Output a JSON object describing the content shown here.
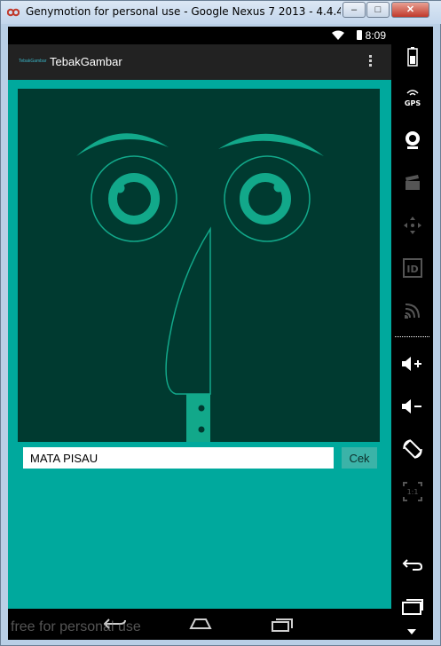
{
  "window": {
    "title": "Genymotion for personal use - Google Nexus 7 2013 - 4.4.4 - API...",
    "min_glyph": "–",
    "max_glyph": "□",
    "close_glyph": "✕"
  },
  "statusbar": {
    "time": "8:09"
  },
  "actionbar": {
    "logo_text": "TebakGambar",
    "title": "TebakGambar"
  },
  "main": {
    "answer_value": "MATA PISAU",
    "check_label": "Cek"
  },
  "watermark": "free for personal use",
  "colors": {
    "content_bg": "#00a99d",
    "picture_bg": "#003a30",
    "accent": "#12a88a"
  }
}
